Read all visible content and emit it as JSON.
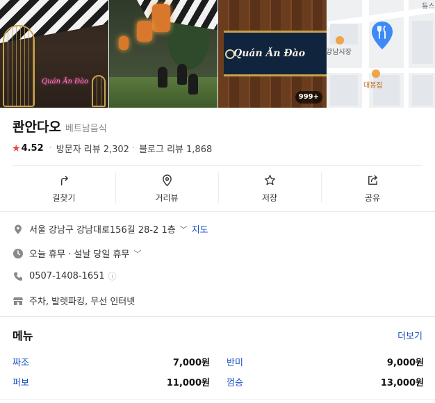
{
  "photos": {
    "photo1_neon": "Quán Ăn Đào",
    "photo3_sign": "Quán Ăn Đào",
    "photo_count": "999+",
    "map_labels": [
      "듀스",
      "강남시장",
      "대봉집"
    ]
  },
  "place": {
    "name": "콴안다오",
    "category": "베트남음식",
    "rating": "4.52",
    "visitor_reviews_label": "방문자 리뷰",
    "visitor_reviews_count": "2,302",
    "blog_reviews_label": "블로그 리뷰",
    "blog_reviews_count": "1,868"
  },
  "actions": [
    {
      "label": "길찾기",
      "icon": "directions-icon"
    },
    {
      "label": "거리뷰",
      "icon": "street-view-pin-icon"
    },
    {
      "label": "저장",
      "icon": "star-outline-icon"
    },
    {
      "label": "공유",
      "icon": "share-icon"
    }
  ],
  "info": {
    "address": "서울 강남구 강남대로156길 28-2 1층",
    "map_link": "지도",
    "hours": "오늘 휴무 · 설날 당일 휴무",
    "phone": "0507-1408-1651",
    "amenities": "주차, 발렛파킹, 무선 인터넷"
  },
  "menu": {
    "title": "메뉴",
    "more_label": "더보기",
    "items": [
      {
        "name": "짜조",
        "price": "7,000원"
      },
      {
        "name": "반미",
        "price": "9,000원"
      },
      {
        "name": "퍼보",
        "price": "11,000원"
      },
      {
        "name": "껌승",
        "price": "13,000원"
      }
    ]
  },
  "colors": {
    "accent_link": "#1a4fc4",
    "star": "#e8484b",
    "map_pin": "#3d8af7"
  }
}
